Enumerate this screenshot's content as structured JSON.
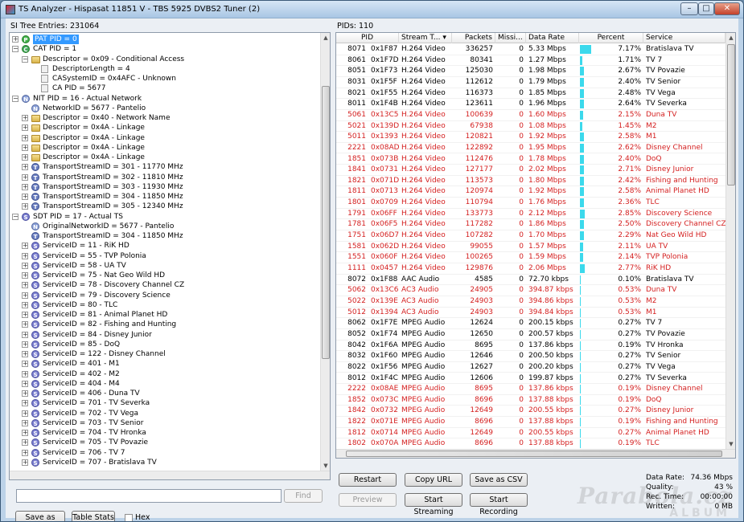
{
  "window": {
    "title": "TS Analyzer - Hispasat 11851 V - TBS 5925 DVBS2 Tuner (2)",
    "min": "–",
    "max": "□",
    "close": "✕"
  },
  "tree": {
    "header": "SI Tree Entries: 231064",
    "nodes": [
      {
        "level": 0,
        "exp": "+",
        "icon": "P",
        "text": "PAT PID = 0",
        "sel": true
      },
      {
        "level": 0,
        "exp": "−",
        "icon": "C",
        "text": "CAT PID = 1"
      },
      {
        "level": 1,
        "exp": "−",
        "icon": "folder",
        "text": "Descriptor = 0x09 - Conditional Access"
      },
      {
        "level": 2,
        "exp": "",
        "icon": "doc",
        "text": "DescriptorLength = 4"
      },
      {
        "level": 2,
        "exp": "",
        "icon": "doc",
        "text": "CASystemID = 0x4AFC - Unknown"
      },
      {
        "level": 2,
        "exp": "",
        "icon": "doc",
        "text": "CA PID = 5677"
      },
      {
        "level": 0,
        "exp": "−",
        "icon": "N",
        "text": "NIT PID = 16 - Actual Network"
      },
      {
        "level": 1,
        "exp": "",
        "icon": "N",
        "text": "NetworkID = 5677 - Pantelio"
      },
      {
        "level": 1,
        "exp": "+",
        "icon": "folder",
        "text": "Descriptor = 0x40 - Network Name"
      },
      {
        "level": 1,
        "exp": "+",
        "icon": "folder",
        "text": "Descriptor = 0x4A - Linkage"
      },
      {
        "level": 1,
        "exp": "+",
        "icon": "folder",
        "text": "Descriptor = 0x4A - Linkage"
      },
      {
        "level": 1,
        "exp": "+",
        "icon": "folder",
        "text": "Descriptor = 0x4A - Linkage"
      },
      {
        "level": 1,
        "exp": "+",
        "icon": "folder",
        "text": "Descriptor = 0x4A - Linkage"
      },
      {
        "level": 1,
        "exp": "+",
        "icon": "T",
        "text": "TransportStreamID = 301 - 11770 MHz"
      },
      {
        "level": 1,
        "exp": "+",
        "icon": "T",
        "text": "TransportStreamID = 302 - 11810 MHz"
      },
      {
        "level": 1,
        "exp": "+",
        "icon": "T",
        "text": "TransportStreamID = 303 - 11930 MHz"
      },
      {
        "level": 1,
        "exp": "+",
        "icon": "T",
        "text": "TransportStreamID = 304 - 11850 MHz"
      },
      {
        "level": 1,
        "exp": "+",
        "icon": "T",
        "text": "TransportStreamID = 305 - 12340 MHz"
      },
      {
        "level": 0,
        "exp": "−",
        "icon": "S",
        "text": "SDT PID = 17 - Actual TS"
      },
      {
        "level": 1,
        "exp": "",
        "icon": "N",
        "text": "OriginalNetworkID = 5677 - Pantelio"
      },
      {
        "level": 1,
        "exp": "",
        "icon": "T",
        "text": "TransportStreamID = 304 - 11850 MHz"
      },
      {
        "level": 1,
        "exp": "+",
        "icon": "S",
        "text": "ServiceID = 11 - RiK HD"
      },
      {
        "level": 1,
        "exp": "+",
        "icon": "S",
        "text": "ServiceID = 55 - TVP Polonia"
      },
      {
        "level": 1,
        "exp": "+",
        "icon": "S",
        "text": "ServiceID = 58 - UA TV"
      },
      {
        "level": 1,
        "exp": "+",
        "icon": "S",
        "text": "ServiceID = 75 - Nat Geo Wild HD"
      },
      {
        "level": 1,
        "exp": "+",
        "icon": "S",
        "text": "ServiceID = 78 - Discovery Channel CZ"
      },
      {
        "level": 1,
        "exp": "+",
        "icon": "S",
        "text": "ServiceID = 79 - Discovery Science"
      },
      {
        "level": 1,
        "exp": "+",
        "icon": "S",
        "text": "ServiceID = 80 - TLC"
      },
      {
        "level": 1,
        "exp": "+",
        "icon": "S",
        "text": "ServiceID = 81 - Animal Planet HD"
      },
      {
        "level": 1,
        "exp": "+",
        "icon": "S",
        "text": "ServiceID = 82 - Fishing and Hunting"
      },
      {
        "level": 1,
        "exp": "+",
        "icon": "S",
        "text": "ServiceID = 84 - Disney Junior"
      },
      {
        "level": 1,
        "exp": "+",
        "icon": "S",
        "text": "ServiceID = 85 - DoQ"
      },
      {
        "level": 1,
        "exp": "+",
        "icon": "S",
        "text": "ServiceID = 122 - Disney Channel"
      },
      {
        "level": 1,
        "exp": "+",
        "icon": "S",
        "text": "ServiceID = 401 - M1"
      },
      {
        "level": 1,
        "exp": "+",
        "icon": "S",
        "text": "ServiceID = 402 - M2"
      },
      {
        "level": 1,
        "exp": "+",
        "icon": "S",
        "text": "ServiceID = 404 - M4"
      },
      {
        "level": 1,
        "exp": "+",
        "icon": "S",
        "text": "ServiceID = 406 - Duna TV"
      },
      {
        "level": 1,
        "exp": "+",
        "icon": "S",
        "text": "ServiceID = 701 - TV Severka"
      },
      {
        "level": 1,
        "exp": "+",
        "icon": "S",
        "text": "ServiceID = 702 - TV Vega"
      },
      {
        "level": 1,
        "exp": "+",
        "icon": "S",
        "text": "ServiceID = 703 - TV Senior"
      },
      {
        "level": 1,
        "exp": "+",
        "icon": "S",
        "text": "ServiceID = 704 - TV Hronka"
      },
      {
        "level": 1,
        "exp": "+",
        "icon": "S",
        "text": "ServiceID = 705 - TV Povazie"
      },
      {
        "level": 1,
        "exp": "+",
        "icon": "S",
        "text": "ServiceID = 706 - TV 7"
      },
      {
        "level": 1,
        "exp": "+",
        "icon": "S",
        "text": "ServiceID = 707 - Bratislava TV"
      }
    ]
  },
  "find": {
    "value": "",
    "button": "Find"
  },
  "left_buttons": {
    "save_xml": "Save as XML",
    "table_stats": "Table Stats",
    "hex": "Hex"
  },
  "pids": {
    "header": "PIDs: 110",
    "columns": [
      "PID",
      "Stream T...",
      "Packets",
      "Missi...",
      "Data Rate",
      "Percent",
      "Service"
    ],
    "sort_arrow": "▾",
    "scrambled_color": "#d42020",
    "bar_color": "#3cd9ec",
    "rows": [
      {
        "pid": "8071",
        "hex": "0x1F87",
        "type": "H.264 Video",
        "packets": "336257",
        "miss": "0",
        "rate": "5.33 Mbps",
        "pct": "7.17%",
        "p": 7.17,
        "svc": "Bratislava TV",
        "red": false
      },
      {
        "pid": "8061",
        "hex": "0x1F7D",
        "type": "H.264 Video",
        "packets": "80341",
        "miss": "0",
        "rate": "1.27 Mbps",
        "pct": "1.71%",
        "p": 1.71,
        "svc": "TV 7",
        "red": false
      },
      {
        "pid": "8051",
        "hex": "0x1F73",
        "type": "H.264 Video",
        "packets": "125030",
        "miss": "0",
        "rate": "1.98 Mbps",
        "pct": "2.67%",
        "p": 2.67,
        "svc": "TV Povazie",
        "red": false
      },
      {
        "pid": "8031",
        "hex": "0x1F5F",
        "type": "H.264 Video",
        "packets": "112612",
        "miss": "0",
        "rate": "1.79 Mbps",
        "pct": "2.40%",
        "p": 2.4,
        "svc": "TV Senior",
        "red": false
      },
      {
        "pid": "8021",
        "hex": "0x1F55",
        "type": "H.264 Video",
        "packets": "116373",
        "miss": "0",
        "rate": "1.85 Mbps",
        "pct": "2.48%",
        "p": 2.48,
        "svc": "TV Vega",
        "red": false
      },
      {
        "pid": "8011",
        "hex": "0x1F4B",
        "type": "H.264 Video",
        "packets": "123611",
        "miss": "0",
        "rate": "1.96 Mbps",
        "pct": "2.64%",
        "p": 2.64,
        "svc": "TV Severka",
        "red": false
      },
      {
        "pid": "5061",
        "hex": "0x13C5",
        "type": "H.264 Video",
        "packets": "100639",
        "miss": "0",
        "rate": "1.60 Mbps",
        "pct": "2.15%",
        "p": 2.15,
        "svc": "Duna TV",
        "red": true
      },
      {
        "pid": "5021",
        "hex": "0x139D",
        "type": "H.264 Video",
        "packets": "67938",
        "miss": "0",
        "rate": "1.08 Mbps",
        "pct": "1.45%",
        "p": 1.45,
        "svc": "M2",
        "red": true
      },
      {
        "pid": "5011",
        "hex": "0x1393",
        "type": "H.264 Video",
        "packets": "120821",
        "miss": "0",
        "rate": "1.92 Mbps",
        "pct": "2.58%",
        "p": 2.58,
        "svc": "M1",
        "red": true
      },
      {
        "pid": "2221",
        "hex": "0x08AD",
        "type": "H.264 Video",
        "packets": "122892",
        "miss": "0",
        "rate": "1.95 Mbps",
        "pct": "2.62%",
        "p": 2.62,
        "svc": "Disney Channel",
        "red": true
      },
      {
        "pid": "1851",
        "hex": "0x073B",
        "type": "H.264 Video",
        "packets": "112476",
        "miss": "0",
        "rate": "1.78 Mbps",
        "pct": "2.40%",
        "p": 2.4,
        "svc": "DoQ",
        "red": true
      },
      {
        "pid": "1841",
        "hex": "0x0731",
        "type": "H.264 Video",
        "packets": "127177",
        "miss": "0",
        "rate": "2.02 Mbps",
        "pct": "2.71%",
        "p": 2.71,
        "svc": "Disney Junior",
        "red": true
      },
      {
        "pid": "1821",
        "hex": "0x071D",
        "type": "H.264 Video",
        "packets": "113573",
        "miss": "0",
        "rate": "1.80 Mbps",
        "pct": "2.42%",
        "p": 2.42,
        "svc": "Fishing and Hunting",
        "red": true
      },
      {
        "pid": "1811",
        "hex": "0x0713",
        "type": "H.264 Video",
        "packets": "120974",
        "miss": "0",
        "rate": "1.92 Mbps",
        "pct": "2.58%",
        "p": 2.58,
        "svc": "Animal Planet HD",
        "red": true
      },
      {
        "pid": "1801",
        "hex": "0x0709",
        "type": "H.264 Video",
        "packets": "110794",
        "miss": "0",
        "rate": "1.76 Mbps",
        "pct": "2.36%",
        "p": 2.36,
        "svc": "TLC",
        "red": true
      },
      {
        "pid": "1791",
        "hex": "0x06FF",
        "type": "H.264 Video",
        "packets": "133773",
        "miss": "0",
        "rate": "2.12 Mbps",
        "pct": "2.85%",
        "p": 2.85,
        "svc": "Discovery Science",
        "red": true
      },
      {
        "pid": "1781",
        "hex": "0x06F5",
        "type": "H.264 Video",
        "packets": "117282",
        "miss": "0",
        "rate": "1.86 Mbps",
        "pct": "2.50%",
        "p": 2.5,
        "svc": "Discovery Channel CZ",
        "red": true
      },
      {
        "pid": "1751",
        "hex": "0x06D7",
        "type": "H.264 Video",
        "packets": "107282",
        "miss": "0",
        "rate": "1.70 Mbps",
        "pct": "2.29%",
        "p": 2.29,
        "svc": "Nat Geo Wild HD",
        "red": true
      },
      {
        "pid": "1581",
        "hex": "0x062D",
        "type": "H.264 Video",
        "packets": "99055",
        "miss": "0",
        "rate": "1.57 Mbps",
        "pct": "2.11%",
        "p": 2.11,
        "svc": "UA TV",
        "red": true
      },
      {
        "pid": "1551",
        "hex": "0x060F",
        "type": "H.264 Video",
        "packets": "100265",
        "miss": "0",
        "rate": "1.59 Mbps",
        "pct": "2.14%",
        "p": 2.14,
        "svc": "TVP Polonia",
        "red": true
      },
      {
        "pid": "1111",
        "hex": "0x0457",
        "type": "H.264 Video",
        "packets": "129876",
        "miss": "0",
        "rate": "2.06 Mbps",
        "pct": "2.77%",
        "p": 2.77,
        "svc": "RiK HD",
        "red": true
      },
      {
        "pid": "8072",
        "hex": "0x1F88",
        "type": "AAC Audio",
        "packets": "4585",
        "miss": "0",
        "rate": "72.70 kbps",
        "pct": "0.10%",
        "p": 0.1,
        "svc": "Bratislava TV",
        "red": false
      },
      {
        "pid": "5062",
        "hex": "0x13C6",
        "type": "AC3 Audio",
        "packets": "24905",
        "miss": "0",
        "rate": "394.87 kbps",
        "pct": "0.53%",
        "p": 0.53,
        "svc": "Duna TV",
        "red": true
      },
      {
        "pid": "5022",
        "hex": "0x139E",
        "type": "AC3 Audio",
        "packets": "24903",
        "miss": "0",
        "rate": "394.86 kbps",
        "pct": "0.53%",
        "p": 0.53,
        "svc": "M2",
        "red": true
      },
      {
        "pid": "5012",
        "hex": "0x1394",
        "type": "AC3 Audio",
        "packets": "24903",
        "miss": "0",
        "rate": "394.84 kbps",
        "pct": "0.53%",
        "p": 0.53,
        "svc": "M1",
        "red": true
      },
      {
        "pid": "8062",
        "hex": "0x1F7E",
        "type": "MPEG Audio",
        "packets": "12624",
        "miss": "0",
        "rate": "200.15 kbps",
        "pct": "0.27%",
        "p": 0.27,
        "svc": "TV 7",
        "red": false
      },
      {
        "pid": "8052",
        "hex": "0x1F74",
        "type": "MPEG Audio",
        "packets": "12650",
        "miss": "0",
        "rate": "200.57 kbps",
        "pct": "0.27%",
        "p": 0.27,
        "svc": "TV Povazie",
        "red": false
      },
      {
        "pid": "8042",
        "hex": "0x1F6A",
        "type": "MPEG Audio",
        "packets": "8695",
        "miss": "0",
        "rate": "137.86 kbps",
        "pct": "0.19%",
        "p": 0.19,
        "svc": "TV Hronka",
        "red": false
      },
      {
        "pid": "8032",
        "hex": "0x1F60",
        "type": "MPEG Audio",
        "packets": "12646",
        "miss": "0",
        "rate": "200.50 kbps",
        "pct": "0.27%",
        "p": 0.27,
        "svc": "TV Senior",
        "red": false
      },
      {
        "pid": "8022",
        "hex": "0x1F56",
        "type": "MPEG Audio",
        "packets": "12627",
        "miss": "0",
        "rate": "200.20 kbps",
        "pct": "0.27%",
        "p": 0.27,
        "svc": "TV Vega",
        "red": false
      },
      {
        "pid": "8012",
        "hex": "0x1F4C",
        "type": "MPEG Audio",
        "packets": "12606",
        "miss": "0",
        "rate": "199.87 kbps",
        "pct": "0.27%",
        "p": 0.27,
        "svc": "TV Severka",
        "red": false
      },
      {
        "pid": "2222",
        "hex": "0x08AE",
        "type": "MPEG Audio",
        "packets": "8695",
        "miss": "0",
        "rate": "137.86 kbps",
        "pct": "0.19%",
        "p": 0.19,
        "svc": "Disney Channel",
        "red": true
      },
      {
        "pid": "1852",
        "hex": "0x073C",
        "type": "MPEG Audio",
        "packets": "8696",
        "miss": "0",
        "rate": "137.88 kbps",
        "pct": "0.19%",
        "p": 0.19,
        "svc": "DoQ",
        "red": true
      },
      {
        "pid": "1842",
        "hex": "0x0732",
        "type": "MPEG Audio",
        "packets": "12649",
        "miss": "0",
        "rate": "200.55 kbps",
        "pct": "0.27%",
        "p": 0.27,
        "svc": "Disney Junior",
        "red": true
      },
      {
        "pid": "1822",
        "hex": "0x071E",
        "type": "MPEG Audio",
        "packets": "8696",
        "miss": "0",
        "rate": "137.88 kbps",
        "pct": "0.19%",
        "p": 0.19,
        "svc": "Fishing and Hunting",
        "red": true
      },
      {
        "pid": "1812",
        "hex": "0x0714",
        "type": "MPEG Audio",
        "packets": "12649",
        "miss": "0",
        "rate": "200.55 kbps",
        "pct": "0.27%",
        "p": 0.27,
        "svc": "Animal Planet HD",
        "red": true
      },
      {
        "pid": "1802",
        "hex": "0x070A",
        "type": "MPEG Audio",
        "packets": "8696",
        "miss": "0",
        "rate": "137.88 kbps",
        "pct": "0.19%",
        "p": 0.19,
        "svc": "TLC",
        "red": true
      }
    ]
  },
  "right_buttons": {
    "restart": "Restart",
    "copy_url": "Copy URL",
    "save_csv": "Save as CSV",
    "preview": "Preview",
    "start_streaming": "Start Streaming",
    "start_recording": "Start Recording"
  },
  "stats": [
    {
      "label": "Data Rate:",
      "value": "74.36 Mbps"
    },
    {
      "label": "Quality:",
      "value": "43 %"
    },
    {
      "label": "Rec. Time:",
      "value": "00:00:00"
    },
    {
      "label": "Written:",
      "value": "0 MB"
    }
  ],
  "watermark": {
    "line1": "Parabola.cz",
    "line2": "ALBUM"
  }
}
